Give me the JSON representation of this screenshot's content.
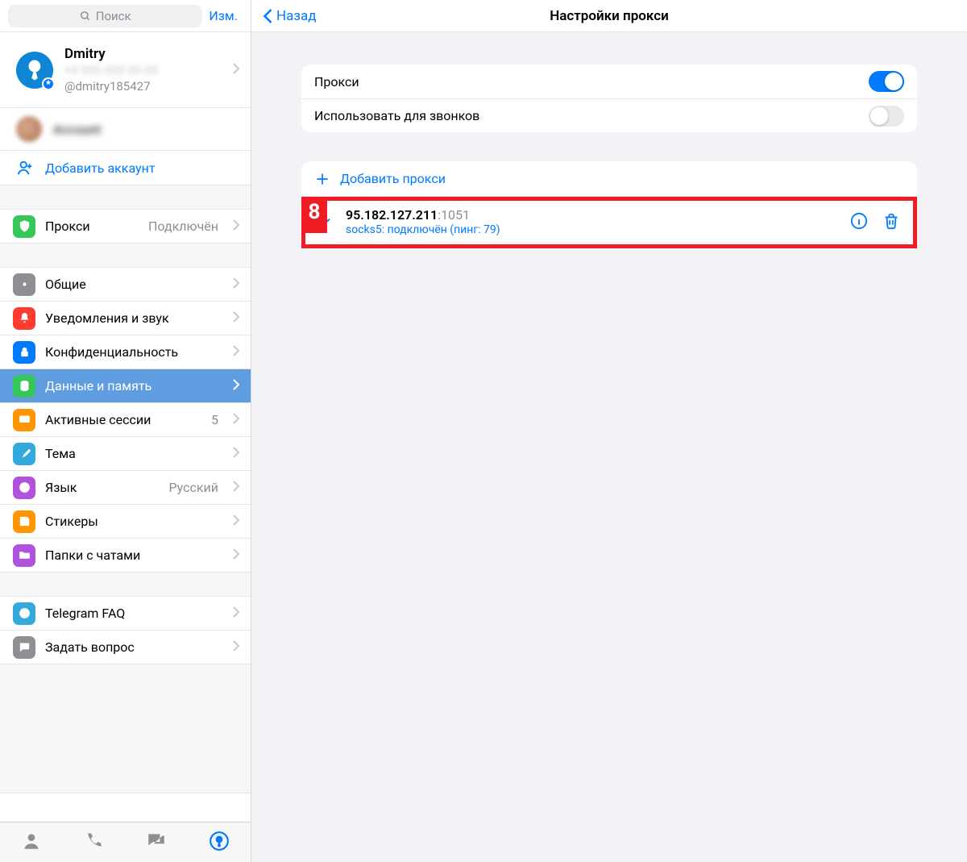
{
  "sidebar": {
    "search_placeholder": "Поиск",
    "edit_label": "Изм.",
    "profile": {
      "name": "Dmitry",
      "username": "@dmitry185427"
    },
    "add_account_label": "Добавить аккаунт",
    "proxy_item": {
      "label": "Прокси",
      "value": "Подключён"
    },
    "general_item": {
      "label": "Общие"
    },
    "notifications_item": {
      "label": "Уведомления и звук"
    },
    "privacy_item": {
      "label": "Конфиденциальность"
    },
    "data_item": {
      "label": "Данные и память"
    },
    "sessions_item": {
      "label": "Активные сессии",
      "value": "5"
    },
    "theme_item": {
      "label": "Тема"
    },
    "language_item": {
      "label": "Язык",
      "value": "Русский"
    },
    "stickers_item": {
      "label": "Стикеры"
    },
    "folders_item": {
      "label": "Папки с чатами"
    },
    "faq_item": {
      "label": "Telegram FAQ"
    },
    "ask_item": {
      "label": "Задать вопрос"
    }
  },
  "main": {
    "back_label": "Назад",
    "title": "Настройки прокси",
    "proxy_toggle_label": "Прокси",
    "calls_toggle_label": "Использовать для звонков",
    "add_proxy_label": "Добавить прокси",
    "highlight_number": "8",
    "entry": {
      "address": "95.182.127.211",
      "port": ":1051",
      "status": "socks5: подключён (пинг: 79)"
    }
  },
  "colors": {
    "ic_proxy": "#35c759",
    "ic_general": "#8e8e93",
    "ic_notif": "#ff3b30",
    "ic_priv": "#007aff",
    "ic_data": "#35c759",
    "ic_sess": "#ff9500",
    "ic_theme": "#007aff",
    "ic_lang": "#af52de",
    "ic_stick": "#ff9500",
    "ic_fold": "#af52de",
    "ic_faq": "#007aff",
    "ic_ask": "#8e8e93"
  }
}
